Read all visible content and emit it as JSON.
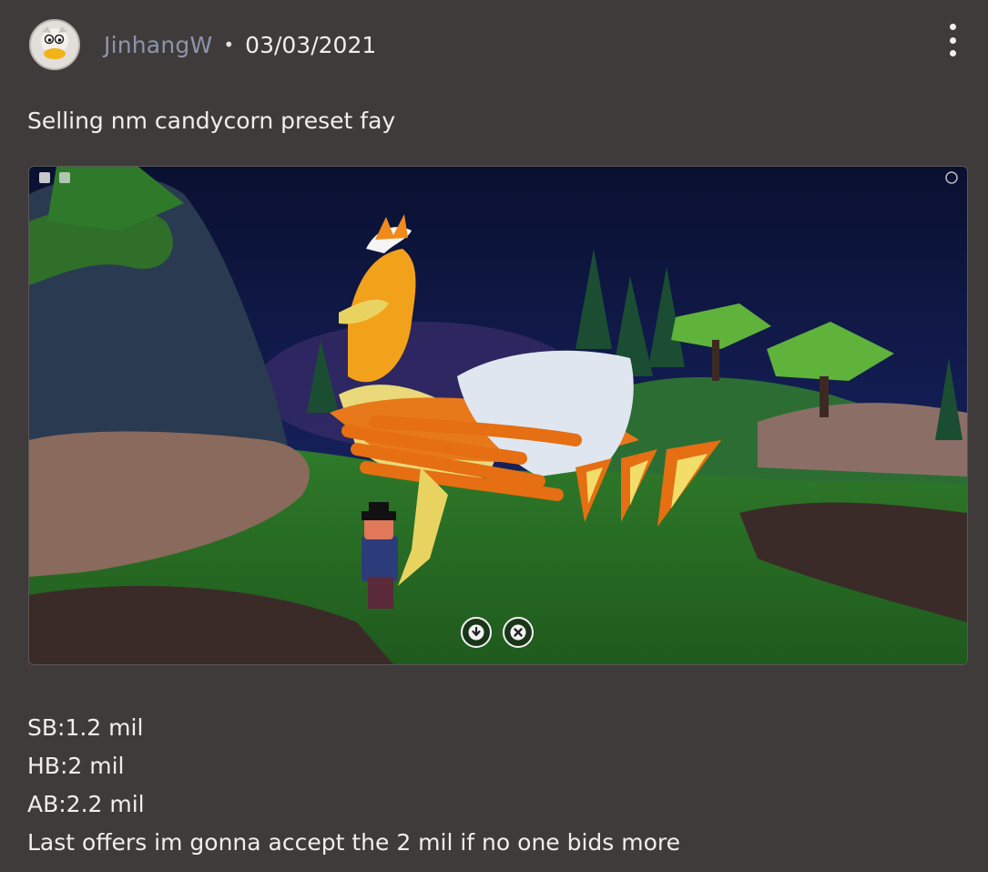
{
  "post": {
    "username": "JinhangW",
    "separator": "•",
    "date": "03/03/2021",
    "title": "Selling nm candycorn preset fay",
    "lines": [
      "SB:1.2 mil",
      "HB:2 mil",
      "AB:2.2 mil",
      "Last offers im gonna accept the 2 mil if no one bids more"
    ]
  },
  "icons": {
    "avatar": "duck-avatar",
    "menu": "more-vertical-icon",
    "download": "download-icon",
    "close": "close-icon"
  },
  "colors": {
    "background": "#3f3b3b",
    "username": "#8c95ab",
    "text": "#f1eeee"
  }
}
